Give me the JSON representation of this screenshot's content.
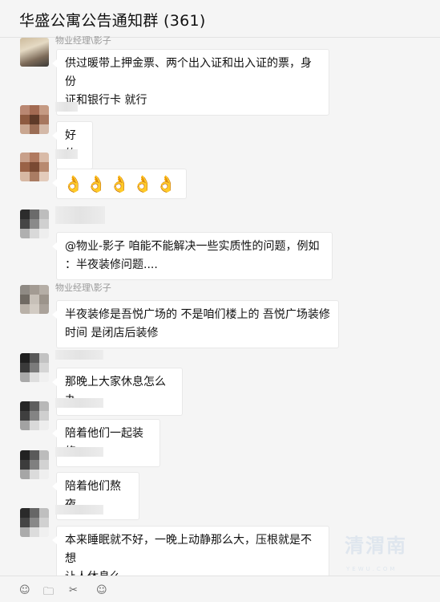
{
  "window": {
    "title": "华盛公寓公告通知群 (361)"
  },
  "messages": [
    {
      "sender": "物业经理\\影子",
      "text": "供过暖带上押金票、两个出入证和出入证的票，身份证和银行卡 就行",
      "line1": "供过暖带上押金票、两个出入证和出入证的票，身份",
      "line2": "证和银行卡 就行"
    },
    {
      "sender": "",
      "text": "好的"
    },
    {
      "sender": "",
      "emojis": [
        "👌",
        "👌",
        "👌",
        "👌",
        "👌"
      ]
    },
    {
      "sender": "",
      "line1": "@物业-影子   咱能不能解决一些实质性的问题，例如",
      "line2": "：半夜装修问题...."
    },
    {
      "sender": "物业经理\\影子",
      "line1": "半夜装修是吾悦广场的 不是咱们楼上的  吾悦广场装修",
      "line2": "时间 是闭店后装修"
    },
    {
      "sender": "",
      "text": "那晚上大家休息怎么办"
    },
    {
      "sender": "",
      "text": "陪着他们一起装修"
    },
    {
      "sender": "",
      "text": "陪着他们熬夜"
    },
    {
      "sender": "",
      "line1": "本来睡眠就不好，一晚上动静那么大，压根就是不想",
      "line2": "让人休息么"
    }
  ],
  "watermark": {
    "text": "清渭南",
    "sub": "YEWU.COM"
  },
  "toolbar": {
    "emoji_icon": "☺",
    "folder_icon": "🗀",
    "scissors_icon": "✂",
    "chat_icon": "☺"
  },
  "colors": {
    "bubble": "#ffffff",
    "background": "#f5f5f5",
    "emoji": "#f3b23c"
  }
}
